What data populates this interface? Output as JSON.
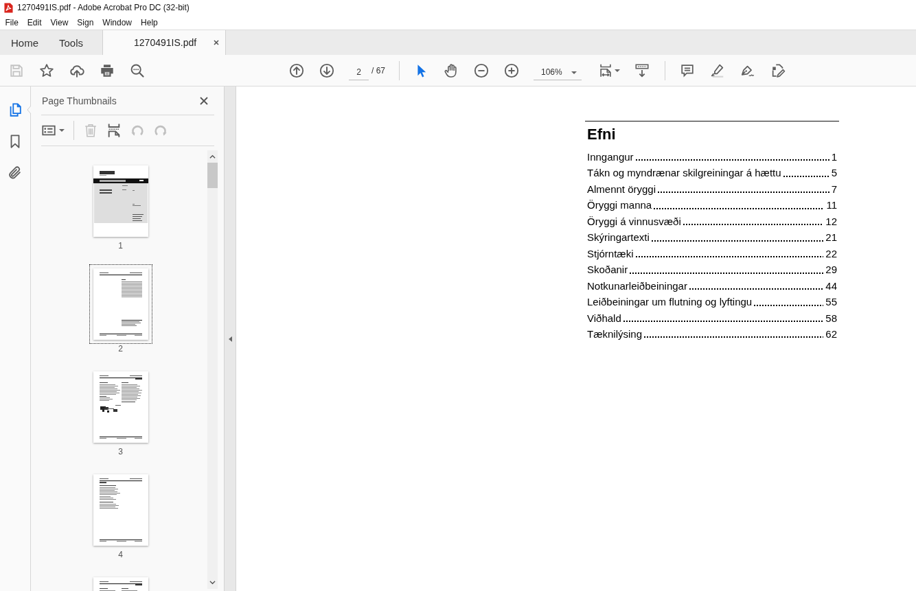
{
  "window": {
    "title": "1270491IS.pdf - Adobe Acrobat Pro DC (32-bit)"
  },
  "menu_bar": [
    "File",
    "Edit",
    "View",
    "Sign",
    "Window",
    "Help"
  ],
  "tabs": [
    {
      "label": "Home",
      "kind": "nav",
      "selected": false
    },
    {
      "label": "Tools",
      "kind": "nav",
      "selected": false
    },
    {
      "label": "1270491IS.pdf",
      "kind": "document",
      "selected": true
    }
  ],
  "toolbar": {
    "save": {
      "disabled": true
    },
    "page_field": {
      "value": "2"
    },
    "page_count": "/ 67",
    "select_tool": {
      "selected": true
    },
    "hand_tool": {
      "selected": false
    },
    "zoom_field": {
      "value": "106%"
    }
  },
  "left_rail": [
    {
      "selected": true
    },
    {
      "selected": false
    },
    {
      "selected": false
    }
  ],
  "sidebar": {
    "title": "Page Thumbnails",
    "tools": [
      {
        "disabled": false
      },
      {
        "disabled": true
      },
      {
        "disabled": false
      },
      {
        "disabled": true
      },
      {
        "disabled": true
      }
    ],
    "thumbnails": [
      {
        "kind": "cover",
        "label": "1",
        "selected": false
      },
      {
        "kind": "contents",
        "label": "2",
        "selected": true
      },
      {
        "kind": "illustrated",
        "label": "3",
        "selected": false
      },
      {
        "kind": "text",
        "label": "4",
        "selected": false
      },
      {
        "kind": "illustrated",
        "selected": false
      }
    ]
  },
  "document": {
    "heading": "Efni",
    "contents": [
      {
        "title": "Inngangur",
        "page": "1"
      },
      {
        "title": "Tákn og myndrænar skilgreiningar á hættu",
        "page": "5"
      },
      {
        "title": "Almennt öryggi",
        "page": "7"
      },
      {
        "title": "Öryggi manna",
        "page": "11"
      },
      {
        "title": "Öryggi á vinnusvæði",
        "page": "12"
      },
      {
        "title": "Skýringartexti",
        "page": "21"
      },
      {
        "title": "Stjórntæki",
        "page": "22"
      },
      {
        "title": "Skoðanir",
        "page": "29"
      },
      {
        "title": "Notkunarleiðbeiningar",
        "page": "44"
      },
      {
        "title": "Leiðbeiningar um flutning og lyftingu",
        "page": "55"
      },
      {
        "title": "Viðhald",
        "page": "58"
      },
      {
        "title": "Tæknilýsing",
        "page": "62"
      }
    ]
  }
}
